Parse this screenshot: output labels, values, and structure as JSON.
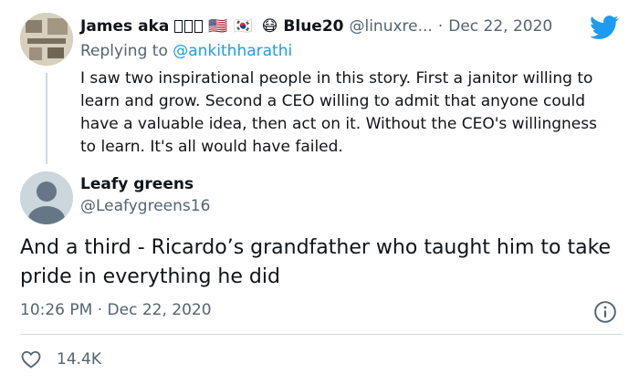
{
  "reply": {
    "name": "James aka",
    "display_name_suffix": "Blue20",
    "handle": "@linuxre...",
    "separator": "·",
    "date": "Dec 22, 2020",
    "replying_prefix": "Replying to ",
    "replying_to": "@ankithharathi",
    "body": "I saw two inspirational people in this story. First a janitor willing to learn and grow. Second a CEO willing to admit that anyone could have a valuable idea, then act on it. Without the CEO's willingness to learn. It's all would have failed.",
    "flag_us": "🇺🇸",
    "flag_kr": "🇰🇷",
    "mask_emoji": "😷"
  },
  "tweet": {
    "name": "Leafy greens",
    "handle": "@Leafygreens16",
    "text": "And a third - Ricardo’s grandfather who taught him to take pride in everything he did",
    "time": "10:26 PM",
    "separator": "·",
    "date": "Dec 22, 2020",
    "like_count": "14.4K"
  },
  "colors": {
    "text": "#0f1419",
    "muted": "#536471",
    "link": "#1d9bf0",
    "divider": "#cfd9de"
  },
  "icons": {
    "bird": "twitter-bird-icon",
    "info": "info-icon",
    "heart": "heart-icon"
  }
}
